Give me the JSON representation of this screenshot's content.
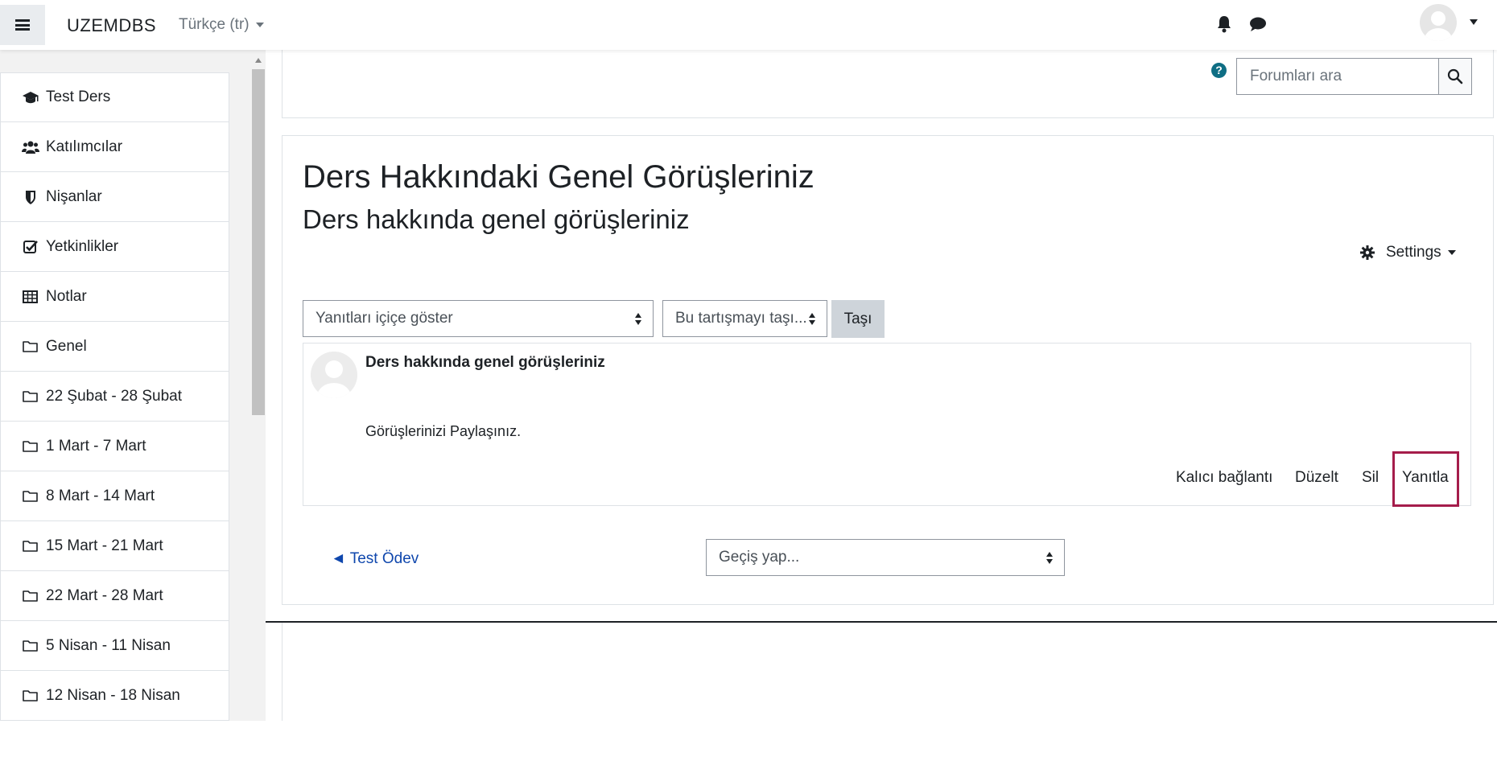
{
  "navbar": {
    "brand": "UZEMDBS",
    "language": "Türkçe ‎(tr)‎"
  },
  "sidebar": {
    "items": [
      {
        "label": "Test Ders",
        "icon": "graduation-cap-icon"
      },
      {
        "label": "Katılımcılar",
        "icon": "users-icon"
      },
      {
        "label": "Nişanlar",
        "icon": "shield-icon"
      },
      {
        "label": "Yetkinlikler",
        "icon": "checkbox-icon"
      },
      {
        "label": "Notlar",
        "icon": "table-icon"
      },
      {
        "label": "Genel",
        "icon": "folder-icon"
      },
      {
        "label": "22 Şubat - 28 Şubat",
        "icon": "folder-icon"
      },
      {
        "label": "1 Mart - 7 Mart",
        "icon": "folder-icon"
      },
      {
        "label": "8 Mart - 14 Mart",
        "icon": "folder-icon"
      },
      {
        "label": "15 Mart - 21 Mart",
        "icon": "folder-icon"
      },
      {
        "label": "22 Mart - 28 Mart",
        "icon": "folder-icon"
      },
      {
        "label": "5 Nisan - 11 Nisan",
        "icon": "folder-icon"
      },
      {
        "label": "12 Nisan - 18 Nisan",
        "icon": "folder-icon"
      }
    ]
  },
  "search": {
    "placeholder": "Forumları ara"
  },
  "page": {
    "title": "Ders Hakkındaki Genel Görüşleriniz",
    "subtitle": "Ders hakkında genel görüşleriniz",
    "settings_label": "Settings"
  },
  "controls": {
    "display_mode": "Yanıtları içiçe göster",
    "move_select": "Bu tartışmayı taşı...",
    "move_button": "Taşı"
  },
  "post": {
    "title": "Ders hakkında genel görüşleriniz",
    "body": "Görüşlerinizi Paylaşınız.",
    "actions": {
      "permalink": "Kalıcı bağlantı",
      "edit": "Düzelt",
      "delete": "Sil",
      "reply": "Yanıtla"
    }
  },
  "footer_nav": {
    "prev_link": "◄ Test Ödev",
    "jump_select": "Geçiş yap..."
  },
  "colors": {
    "link": "#0f47ad",
    "highlight": "#a51d4b",
    "help": "#0f6e84"
  }
}
